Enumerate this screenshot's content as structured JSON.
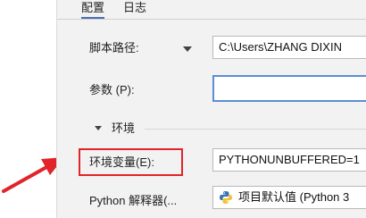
{
  "tabs": [
    {
      "label": "配置",
      "active": true
    },
    {
      "label": "日志",
      "active": false
    }
  ],
  "script_path": {
    "label": "脚本路径:",
    "value": "C:\\Users\\ZHANG DIXIN"
  },
  "parameters": {
    "label": "参数 (P):",
    "value": ""
  },
  "environment_section": {
    "label": "环境"
  },
  "env_variables": {
    "label": "环境变量(E):",
    "value": "PYTHONUNBUFFERED=1"
  },
  "interpreter": {
    "label": "Python 解释器(...",
    "value": "项目默认值 (Python 3"
  },
  "colors": {
    "highlight": "#e0242a",
    "focus": "#5b8ed6"
  },
  "icons": [
    "chevron-down-icon",
    "python-icon",
    "arrow-icon"
  ]
}
